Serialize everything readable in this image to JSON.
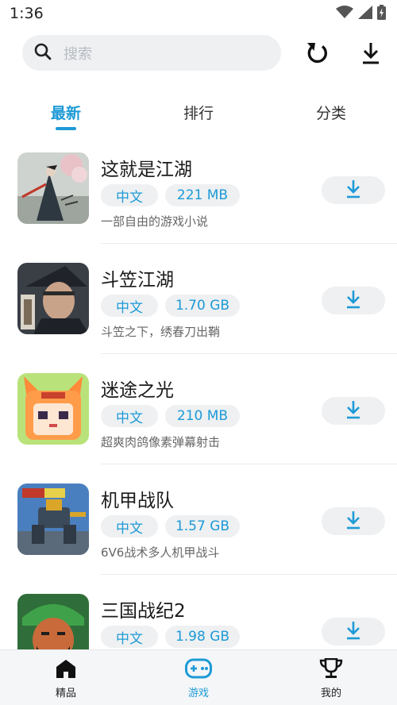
{
  "status_bar": {
    "time": "1:36"
  },
  "search": {
    "placeholder": "搜索"
  },
  "tabs": [
    {
      "label": "最新",
      "active": true
    },
    {
      "label": "排行",
      "active": false
    },
    {
      "label": "分类",
      "active": false
    }
  ],
  "games": [
    {
      "title": "这就是江湖",
      "language": "中文",
      "size": "221 MB",
      "description": "一部自由的游戏小说",
      "icon": "jianghu-ink-icon"
    },
    {
      "title": "斗笠江湖",
      "language": "中文",
      "size": "1.70 GB",
      "description": "斗笠之下，绣春刀出鞘",
      "icon": "douli-warrior-icon"
    },
    {
      "title": "迷途之光",
      "language": "中文",
      "size": "210 MB",
      "description": "超爽肉鸽像素弹幕射击",
      "icon": "pixel-fox-girl-icon"
    },
    {
      "title": "机甲战队",
      "language": "中文",
      "size": "1.57 GB",
      "description": "6V6战术多人机甲战斗",
      "icon": "mech-robot-icon"
    },
    {
      "title": "三国战纪2",
      "language": "中文",
      "size": "1.98 GB",
      "description": "",
      "icon": "guan-yu-icon"
    }
  ],
  "bottom_nav": [
    {
      "label": "精品",
      "icon": "home-icon",
      "active": false
    },
    {
      "label": "游戏",
      "icon": "gamepad-icon",
      "active": true
    },
    {
      "label": "我的",
      "icon": "trophy-icon",
      "active": false
    }
  ],
  "colors": {
    "accent": "#1d9ad6",
    "chip_bg": "#eef0f2",
    "text": "#1a1a1a",
    "secondary_text": "#666666"
  }
}
